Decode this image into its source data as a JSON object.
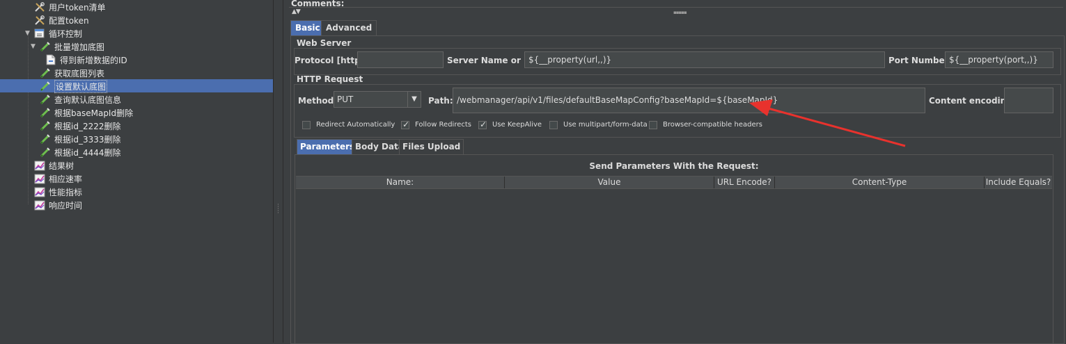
{
  "tree": {
    "items": [
      {
        "label": "用户token清单",
        "icon": "sampler-tool-icon"
      },
      {
        "label": "配置token",
        "icon": "config-tool-icon"
      },
      {
        "label": "循环控制",
        "icon": "loop-controller-icon",
        "expanded": true
      },
      {
        "label": "批量增加底图",
        "icon": "http-sampler-icon",
        "expanded": true
      },
      {
        "label": "得到新增数据的ID",
        "icon": "extractor-icon"
      },
      {
        "label": "获取底图列表",
        "icon": "http-sampler-icon"
      },
      {
        "label": "设置默认底图",
        "icon": "http-sampler-icon",
        "selected": true
      },
      {
        "label": "查询默认底图信息",
        "icon": "http-sampler-icon"
      },
      {
        "label": "根据baseMapId删除",
        "icon": "http-sampler-icon"
      },
      {
        "label": "根据id_2222删除",
        "icon": "http-sampler-icon"
      },
      {
        "label": "根据id_3333删除",
        "icon": "http-sampler-icon"
      },
      {
        "label": "根据id_4444删除",
        "icon": "http-sampler-icon"
      },
      {
        "label": "结果树",
        "icon": "listener-graph-icon"
      },
      {
        "label": "相应速率",
        "icon": "listener-graph-icon"
      },
      {
        "label": "性能指标",
        "icon": "listener-graph-icon"
      },
      {
        "label": "响应时间",
        "icon": "listener-graph-icon"
      }
    ]
  },
  "comments": {
    "label": "Comments:"
  },
  "tabs": {
    "basic": "Basic",
    "advanced": "Advanced"
  },
  "web_server": {
    "title": "Web Server",
    "protocol_label": "Protocol [http]:",
    "protocol_value": "",
    "server_label": "Server Name or IP:",
    "server_value": "${__property(url,,)}",
    "port_label": "Port Number:",
    "port_value": "${__property(port,,)}"
  },
  "http_request": {
    "title": "HTTP Request",
    "method_label": "Method:",
    "method_value": "PUT",
    "path_label": "Path:",
    "path_value": "/webmanager/api/v1/files/defaultBaseMapConfig?baseMapId=${baseMapId}",
    "encoding_label": "Content encoding:",
    "encoding_value": ""
  },
  "options": [
    {
      "label": "Redirect Automatically",
      "checked": false
    },
    {
      "label": "Follow Redirects",
      "checked": true
    },
    {
      "label": "Use KeepAlive",
      "checked": true
    },
    {
      "label": "Use multipart/form-data",
      "checked": false
    },
    {
      "label": "Browser-compatible headers",
      "checked": false
    }
  ],
  "subtabs": {
    "parameters": "Parameters",
    "body_data": "Body Data",
    "files_upload": "Files Upload"
  },
  "params": {
    "title": "Send Parameters With the Request:",
    "columns": [
      "Name:",
      "Value",
      "URL Encode?",
      "Content-Type",
      "Include Equals?"
    ]
  },
  "colors": {
    "selection": "#4b6eaf",
    "arrow": "#e8322d",
    "background": "#3c3f41"
  }
}
